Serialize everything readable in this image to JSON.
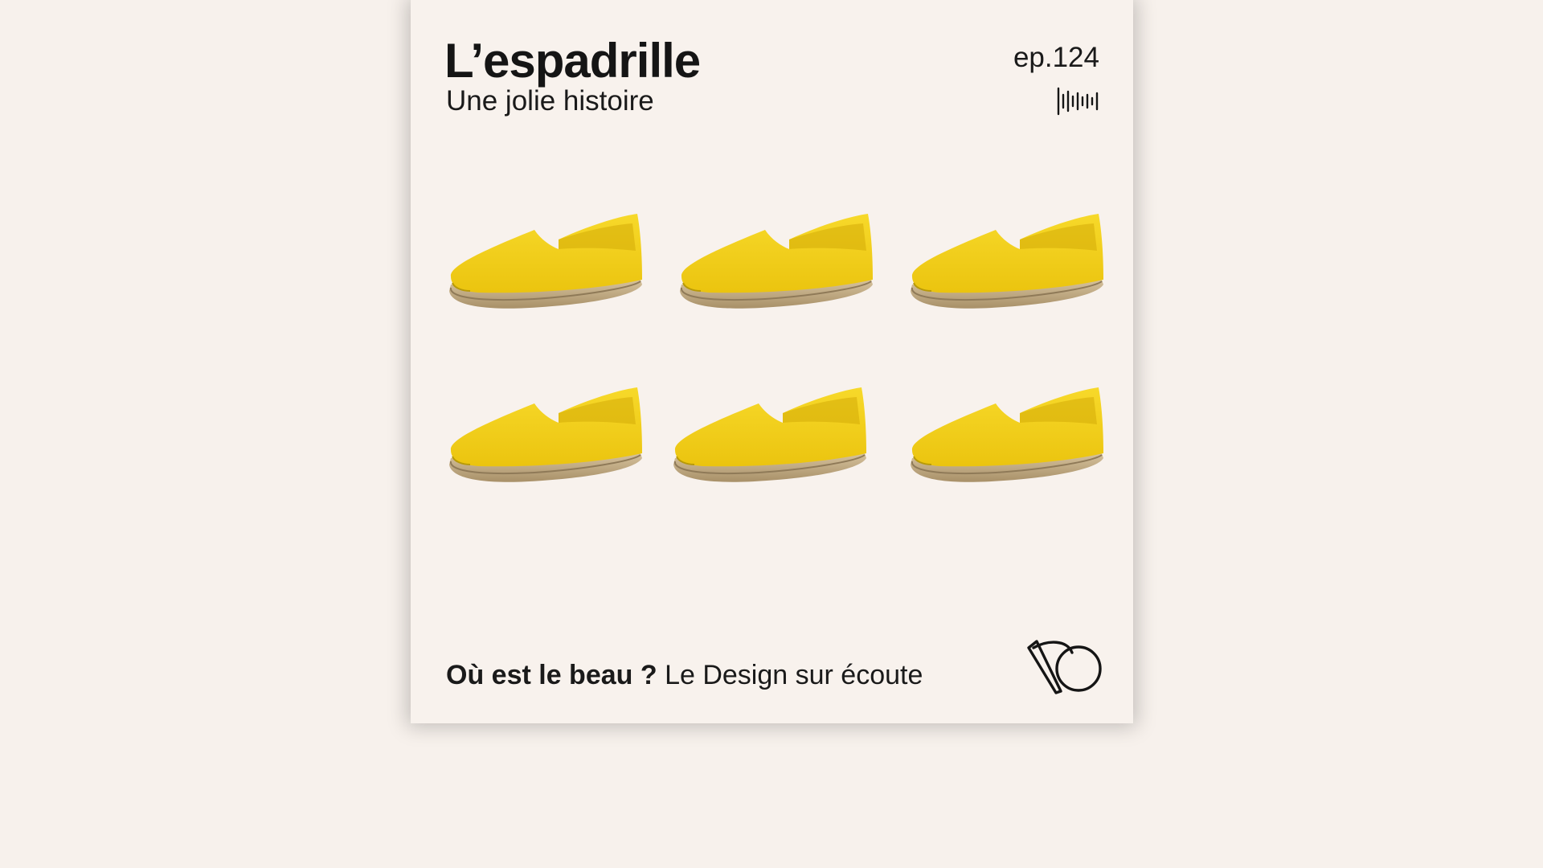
{
  "cover": {
    "title": "L’espadrille",
    "subtitle": "Une jolie histoire",
    "episode": "ep.124",
    "podcast_name": "Où est le beau ?",
    "podcast_tagline": "Le Design sur écoute"
  },
  "icons": {
    "episode_icon": "audio-waveform-icon",
    "logo": "ob-monogram-logo"
  },
  "colors": {
    "background": "#f7f1ec",
    "cover_background": "#f8f2ed",
    "text": "#151515",
    "shoe_canvas": "#f2d21a",
    "shoe_sole": "#c9b48f",
    "wave_start": "#6a4bb0",
    "wave_end": "#5ac8e8"
  }
}
